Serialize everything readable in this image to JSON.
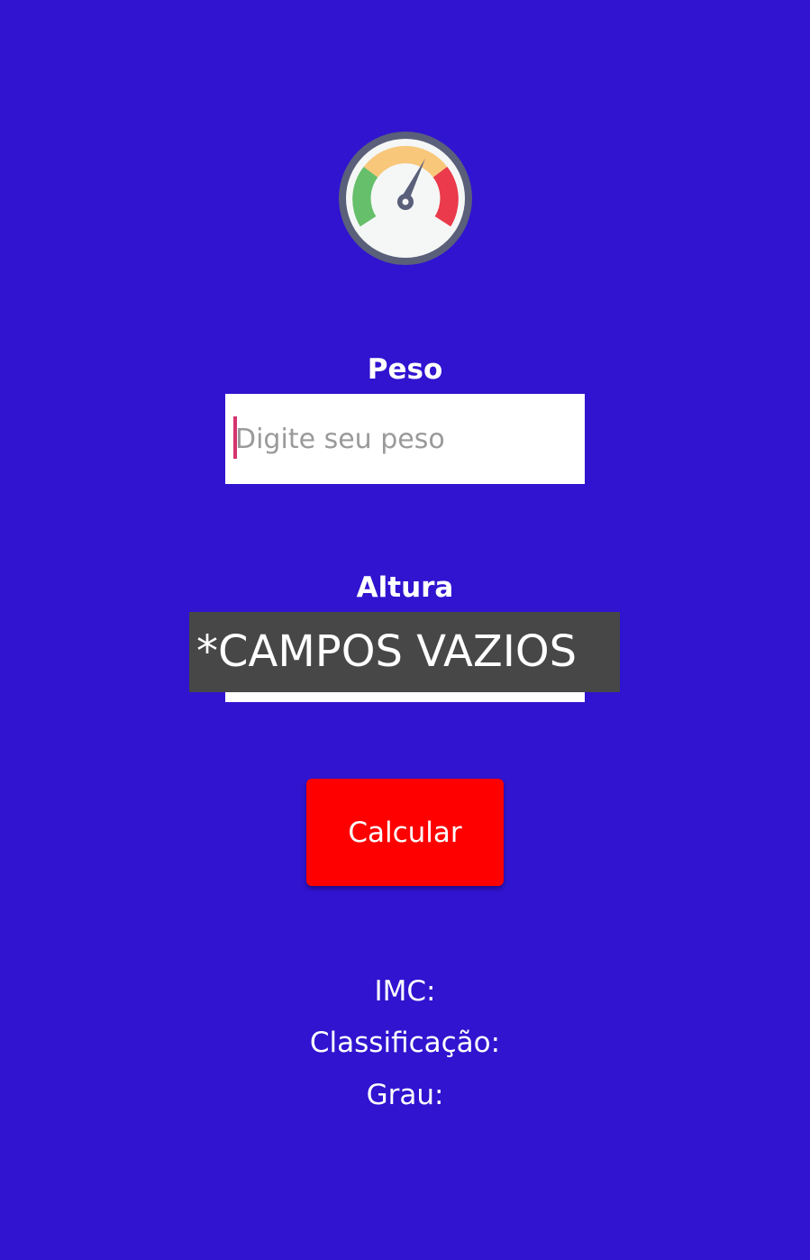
{
  "colors": {
    "background": "#3014d0",
    "button": "#fe0000",
    "toast": "#474747",
    "caret": "#d6336c"
  },
  "logo": {
    "icon": "speedometer-icon"
  },
  "form": {
    "peso_label": "Peso",
    "peso_placeholder": "Digite seu peso",
    "peso_value": "",
    "altura_label": "Altura",
    "altura_value": ""
  },
  "toast": {
    "message": "*CAMPOS VAZIOS"
  },
  "button": {
    "calcular_label": "Calcular"
  },
  "results": {
    "imc_label": "IMC:",
    "classificacao_label": "Classificação:",
    "grau_label": "Grau:"
  }
}
